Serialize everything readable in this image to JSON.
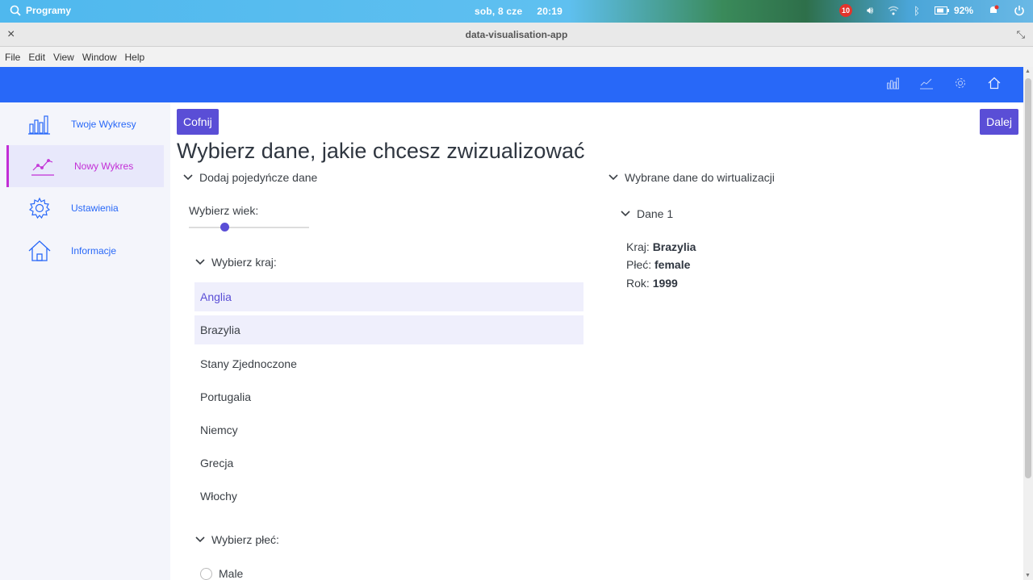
{
  "os_panel": {
    "programs_label": "Programy",
    "date": "sob,  8 cze",
    "time": "20:19",
    "notification_count": "10",
    "battery": "92%"
  },
  "window": {
    "title": "data-visualisation-app"
  },
  "menubar": {
    "items": [
      "File",
      "Edit",
      "View",
      "Window",
      "Help"
    ]
  },
  "sidebar": {
    "items": [
      {
        "label": "Twoje Wykresy",
        "icon": "bar-chart-icon"
      },
      {
        "label": "Nowy Wykres",
        "icon": "line-chart-icon"
      },
      {
        "label": "Ustawienia",
        "icon": "gear-icon"
      },
      {
        "label": "Informacje",
        "icon": "home-icon"
      }
    ]
  },
  "main": {
    "back_label": "Cofnij",
    "next_label": "Dalej",
    "heading": "Wybierz dane, jakie chcesz zwizualizować",
    "left_section": "Dodaj pojedyńcze dane",
    "age_label": "Wybierz wiek:",
    "country_section": "Wybierz kraj:",
    "countries": [
      "Anglia",
      "Brazylia",
      "Stany Zjednoczone",
      "Portugalia",
      "Niemcy",
      "Grecja",
      "Włochy"
    ],
    "gender_section": "Wybierz płeć:",
    "gender_option": "Male",
    "right_section": "Wybrane dane do wirtualizacji",
    "dataset": {
      "name": "Dane 1",
      "country_label": "Kraj:",
      "country_value": "Brazylia",
      "gender_label": "Płeć:",
      "gender_value": "female",
      "year_label": "Rok:",
      "year_value": "1999"
    }
  },
  "colors": {
    "accent": "#2868f8",
    "button": "#5a4ed6",
    "active_nav": "#c22ed6"
  }
}
